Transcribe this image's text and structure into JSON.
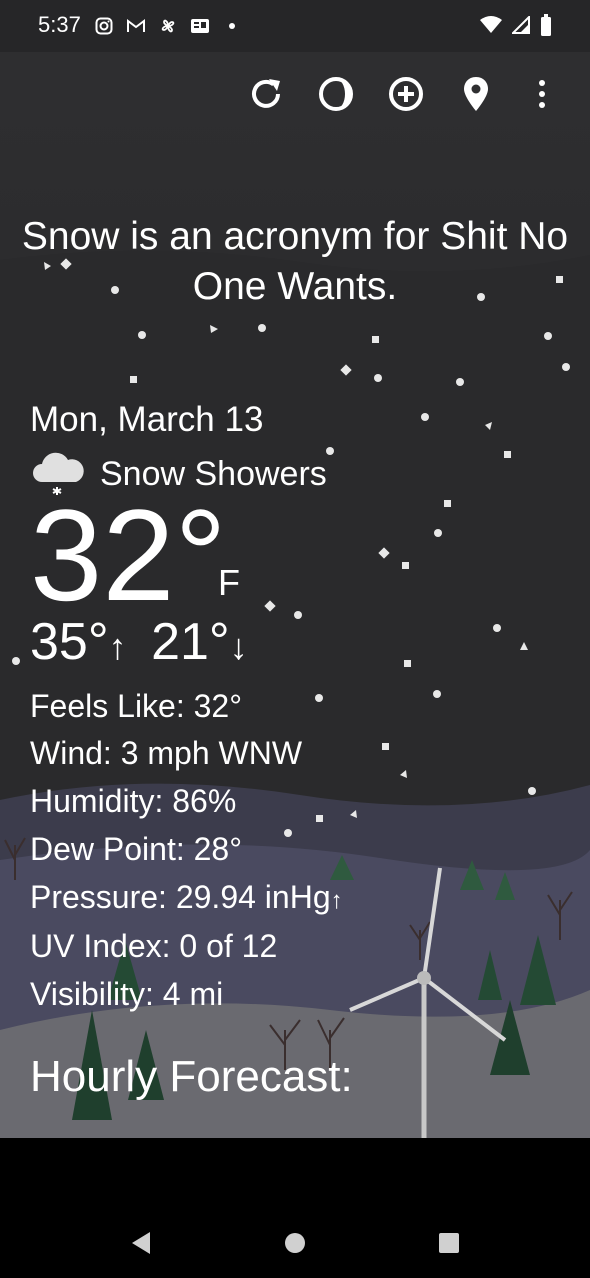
{
  "status": {
    "time": "5:37"
  },
  "toolbar": {
    "refresh_icon": "refresh-icon",
    "theme_icon": "moon-phase-icon",
    "add_icon": "add-circle-icon",
    "location_icon": "location-pin-icon",
    "more_icon": "more-vert-icon"
  },
  "quote": "Snow is an acronym for Shit No One Wants.",
  "weather": {
    "date": "Mon, March 13",
    "condition": "Snow Showers",
    "temperature": "32°",
    "unit": "F",
    "high": "35°",
    "low": "21°",
    "feels_like": "Feels Like:  32°",
    "wind": "Wind:  3 mph WNW",
    "humidity": "Humidity:  86%",
    "dew_point": "Dew Point:  28°",
    "pressure": "Pressure:  29.94 inHg",
    "uv_index": "UV Index:  0 of 12",
    "visibility": "Visibility:  4 mi"
  },
  "hourly_title": "Hourly Forecast:",
  "colors": {
    "background": "#2c2c2e",
    "text": "#ffffff",
    "navbar": "#000000"
  }
}
